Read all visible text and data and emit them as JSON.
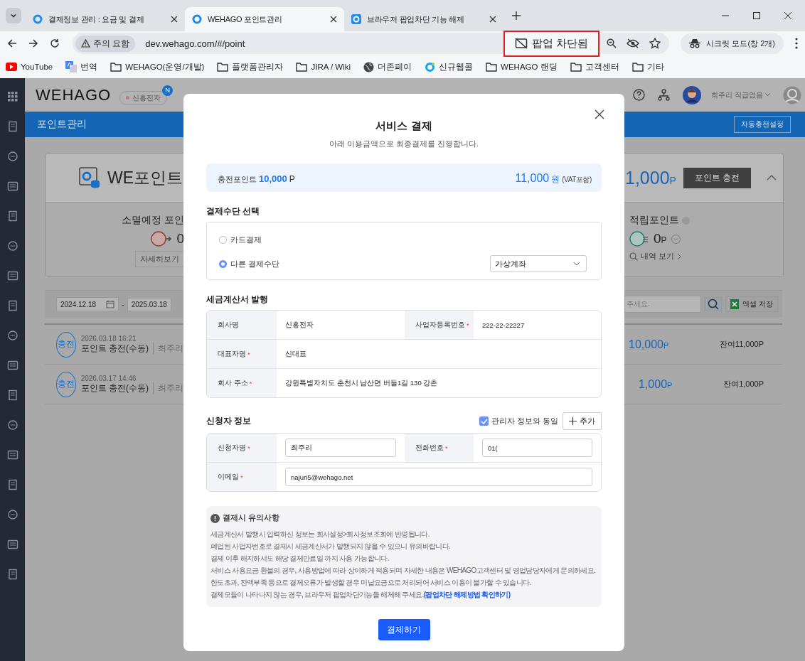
{
  "browser": {
    "tabs": [
      {
        "title": "결제정보 관리 : 요금 및 결제",
        "selected": false
      },
      {
        "title": "WEHAGO 포인트관리",
        "selected": true
      },
      {
        "title": "브라우저 팝업차단 기능 해제",
        "selected": false
      }
    ],
    "address": {
      "security": "주의 요함",
      "url": "dev.wehago.com/#/point"
    },
    "popup_blocked": "팝업 차단됨",
    "profile": "시크릿 모드(창 2개)",
    "bookmarks": [
      {
        "label": "YouTube",
        "kind": "youtube"
      },
      {
        "label": "번역",
        "kind": "translate"
      },
      {
        "label": "WEHAGO(운영/개발)",
        "kind": "folder"
      },
      {
        "label": "플랫폼관리자",
        "kind": "folder"
      },
      {
        "label": "JIRA / Wiki",
        "kind": "folder"
      },
      {
        "label": "더존페이",
        "kind": "globe"
      },
      {
        "label": "신규웹콜",
        "kind": "site"
      },
      {
        "label": "WEHAGO 랜딩",
        "kind": "folder"
      },
      {
        "label": "고객센터",
        "kind": "folder"
      },
      {
        "label": "기타",
        "kind": "folder"
      }
    ]
  },
  "app": {
    "logo": "WEHAGO",
    "company": {
      "name": "신흥전자",
      "badge": "N"
    },
    "user": "최주리 직급없음",
    "page_title": "포인트관리",
    "auto_charge_button": "자동충전설정",
    "card": {
      "title": "WE포인트",
      "balance": "1,000",
      "balance_unit": "P",
      "charge_button": "포인트 충전",
      "expanded": true,
      "expiring": {
        "label": "소멸예정 포인",
        "value": "0",
        "button": "자세히보기"
      },
      "accumulated": {
        "label": "적립포인트",
        "value": "0",
        "unit": "P",
        "link": "내역 보기"
      }
    },
    "filter": {
      "start_date": "2024.12.18",
      "separator": "-",
      "end_date": "2025.03.18",
      "search_placeholder": "주세요.",
      "excel_button": "엑셀 저장"
    },
    "history": [
      {
        "badge": "충전",
        "datetime": "2026.03.18 16:21",
        "title": "포인트 충전(수동)",
        "user": "최주리",
        "amount": "10,000",
        "unit": "P",
        "balance": "잔여11,000P"
      },
      {
        "badge": "충전",
        "datetime": "2026.03.17 14:46",
        "title": "포인트 충전(수동)",
        "user": "최주리",
        "amount": "1,000",
        "unit": "P",
        "balance": "잔여1,000P"
      }
    ]
  },
  "modal": {
    "title": "서비스 결제",
    "subtitle": "아래 이용금액으로 최종결제를 진행합니다.",
    "summary": {
      "label": "충전포인트",
      "points": "10,000",
      "points_unit": "P",
      "price": "11,000",
      "price_unit": "원",
      "vat": "(VAT포함)"
    },
    "payment": {
      "title": "결제수단 선택",
      "options": [
        {
          "label": "카드결제",
          "selected": false
        },
        {
          "label": "다른 결제수단",
          "selected": true
        }
      ],
      "method": "가상계좌"
    },
    "tax": {
      "title": "세금계산서 발행",
      "rows": [
        [
          {
            "label": "회사명",
            "value": "신흥전자"
          },
          {
            "label": "사업자등록번호",
            "required_mark": "*",
            "value": "222-22-22227"
          }
        ],
        [
          {
            "label": "대표자명",
            "required_mark": "*",
            "value": "신대표"
          }
        ],
        [
          {
            "label": "회사 주소",
            "required_mark": "*",
            "value": "강원특별자치도 춘천시 남산면 버들1길 130 강촌"
          }
        ]
      ]
    },
    "applicant": {
      "title": "신청자 정보",
      "same_as_admin": {
        "label": "관리자 정보와 동일",
        "checked": true
      },
      "add_button": "추가",
      "rows": [
        [
          {
            "label": "신청자명",
            "required_mark": "*",
            "value": "최주리"
          },
          {
            "label": "전화번호",
            "required_mark": "*",
            "value": "01("
          }
        ],
        [
          {
            "label": "이메일",
            "required_mark": "*",
            "value": "najuri5@wehago.net"
          }
        ]
      ]
    },
    "notice": {
      "title": "결제시 유의사항",
      "items": [
        {
          "text": "세금계산서 발행시 입력하신 정보는 회사설정>회사정보조회에 반영됩니다."
        },
        {
          "text": "폐업된 사업자번호로 결제시 세금계산서가 발행되지 않을 수 있으니 유의바랍니다."
        },
        {
          "text": "결제 이후 해지하셔도 해당 결제만료일 까지 사용 가능합니다."
        },
        {
          "text": "서비스 사용요금 환불의 경우, 사용방법에 따라 상이하게 적용되며 자세한 내용은 WEHAGO고객센터 및 영업담당자에게 문의하세요."
        },
        {
          "text": "한도초과, 잔액부족 등으로 결제오류가 발생할 경우 미납요금으로 처리되어 서비스 이용이 불가할 수 있습니다."
        },
        {
          "text": "결제모듈이 나타나지 않는 경우, 브라우저 팝업차단기능을 해제해 주세요.",
          "link": "(팝업차단 해제방법 확인하기)"
        }
      ]
    },
    "submit_button": "결제하기"
  }
}
